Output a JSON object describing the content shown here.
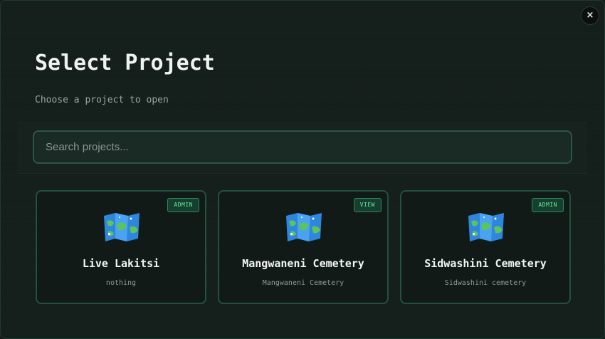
{
  "dialog": {
    "title": "Select Project",
    "subtitle": "Choose a project to open",
    "close_label": "×"
  },
  "search": {
    "placeholder": "Search projects...",
    "value": ""
  },
  "projects": [
    {
      "name": "Live Lakitsi",
      "description": "nothing",
      "role": "ADMIN",
      "icon": "world-map-icon"
    },
    {
      "name": "Mangwaneni Cemetery",
      "description": "Mangwaneni Cemetery",
      "role": "VIEW",
      "icon": "world-map-icon"
    },
    {
      "name": "Sidwashini Cemetery",
      "description": "Sidwashini cemetery",
      "role": "ADMIN",
      "icon": "world-map-icon"
    }
  ],
  "colors": {
    "accent": "#2d8a5c",
    "badge_text": "#6fe3a5",
    "background": "#141e1b"
  }
}
